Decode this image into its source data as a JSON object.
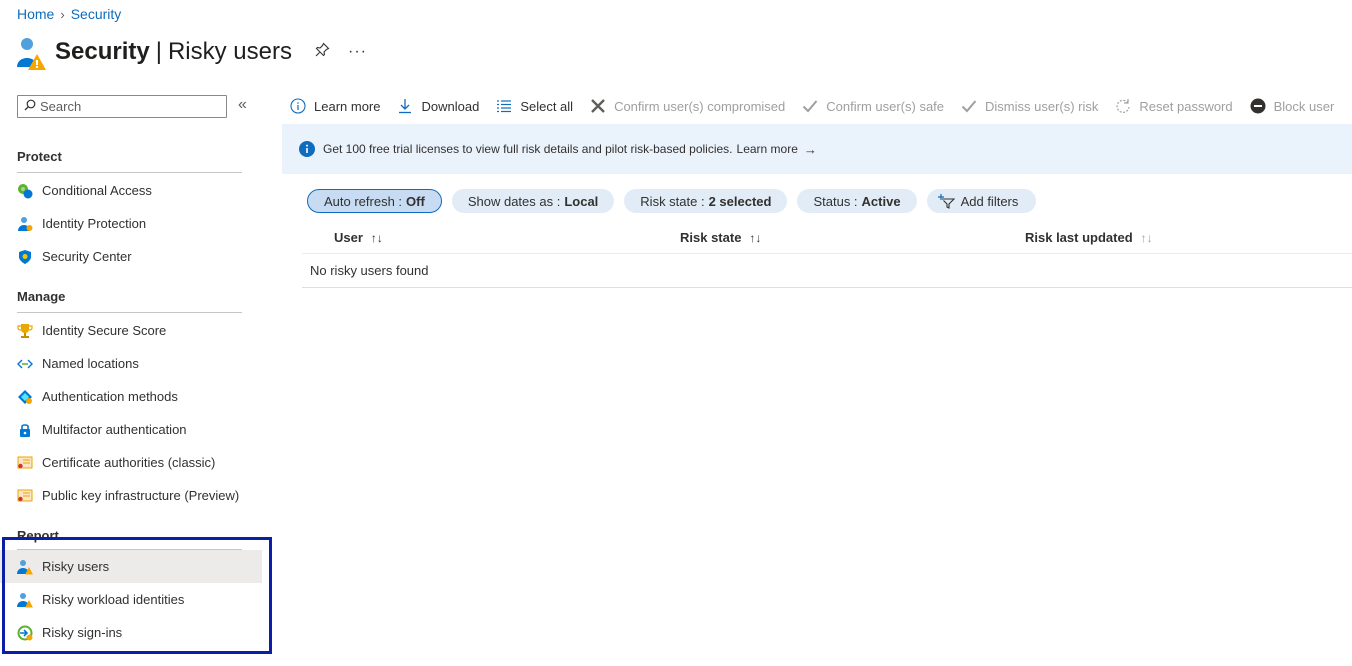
{
  "breadcrumb": {
    "home": "Home",
    "current": "Security"
  },
  "title": {
    "bold": "Security",
    "rest": "Risky users",
    "more": "···"
  },
  "search": {
    "placeholder": "Search",
    "collapse": "«"
  },
  "sidebar": {
    "protect": {
      "heading": "Protect",
      "items": [
        {
          "label": "Conditional Access",
          "icon": "conditional-access-icon"
        },
        {
          "label": "Identity Protection",
          "icon": "identity-protection-icon"
        },
        {
          "label": "Security Center",
          "icon": "security-center-icon"
        }
      ]
    },
    "manage": {
      "heading": "Manage",
      "items": [
        {
          "label": "Identity Secure Score",
          "icon": "trophy-icon"
        },
        {
          "label": "Named locations",
          "icon": "named-locations-icon"
        },
        {
          "label": "Authentication methods",
          "icon": "authentication-methods-icon"
        },
        {
          "label": "Multifactor authentication",
          "icon": "mfa-lock-icon"
        },
        {
          "label": "Certificate authorities (classic)",
          "icon": "certificate-icon"
        },
        {
          "label": "Public key infrastructure (Preview)",
          "icon": "certificate-icon"
        }
      ]
    },
    "report": {
      "heading": "Report",
      "items": [
        {
          "label": "Risky users",
          "icon": "risky-user-icon",
          "selected": true
        },
        {
          "label": "Risky workload identities",
          "icon": "risky-user-icon"
        },
        {
          "label": "Risky sign-ins",
          "icon": "risky-signin-icon"
        }
      ]
    }
  },
  "toolbar": {
    "learn_more": "Learn more",
    "download": "Download",
    "select_all": "Select all",
    "confirm_compromised": "Confirm user(s) compromised",
    "confirm_safe": "Confirm user(s) safe",
    "dismiss_risk": "Dismiss user(s) risk",
    "reset_password": "Reset password",
    "block_user": "Block user",
    "more": "···"
  },
  "info_bar": {
    "text": "Get 100 free trial licenses to view full risk details and pilot risk-based policies.",
    "link": "Learn more",
    "arrow": "→"
  },
  "filters": [
    {
      "key": "Auto refresh :",
      "value": "Off",
      "active": true
    },
    {
      "key": "Show dates as :",
      "value": "Local"
    },
    {
      "key": "Risk state :",
      "value": "2 selected"
    },
    {
      "key": "Status :",
      "value": "Active"
    }
  ],
  "add_filters": "Add filters",
  "grid": {
    "columns": [
      "User",
      "Risk state",
      "Risk last updated"
    ],
    "sort_glyph": "↑↓",
    "empty": "No risky users found"
  },
  "colors": {
    "accent": "#0f6cbd",
    "highlight_border": "#0c1ea8",
    "info_bg": "#eaf2fb",
    "pill_bg": "#e1ecf7"
  }
}
